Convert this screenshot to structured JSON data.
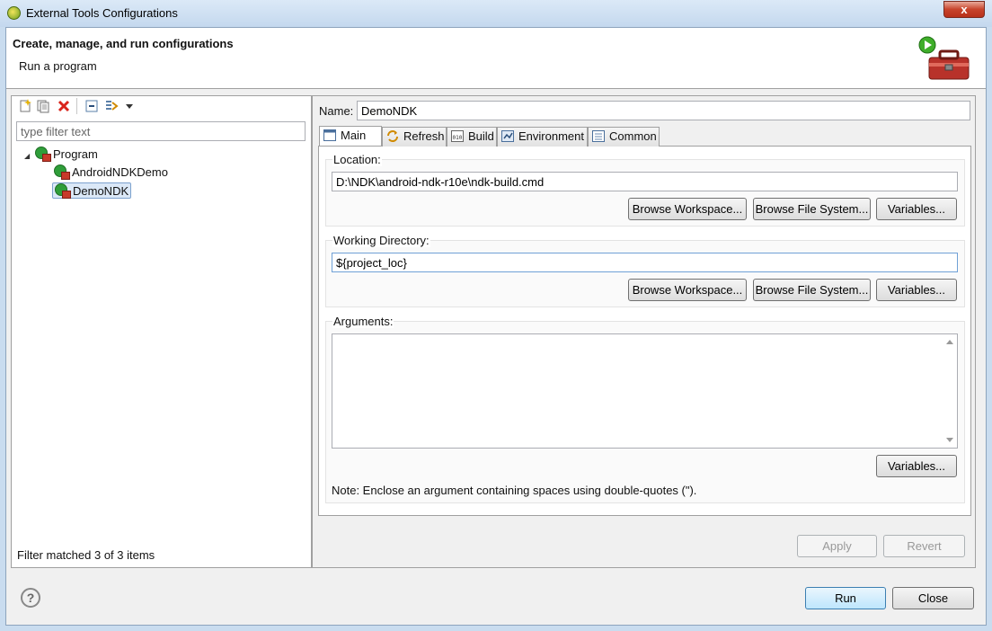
{
  "window": {
    "title": "External Tools Configurations",
    "close_glyph": "x"
  },
  "banner": {
    "title": "Create, manage, and run configurations",
    "subtitle": "Run a program"
  },
  "left": {
    "filter_placeholder": "type filter text",
    "tree": [
      {
        "label": "Program",
        "expander": "◢"
      },
      {
        "label": "AndroidNDKDemo"
      },
      {
        "label": "DemoNDK",
        "selected": true
      }
    ],
    "status": "Filter matched 3 of 3 items"
  },
  "right": {
    "name_label": "Name:",
    "name_value": "DemoNDK",
    "tabs": [
      {
        "label": "Main",
        "active": true
      },
      {
        "label": "Refresh"
      },
      {
        "label": "Build"
      },
      {
        "label": "Environment"
      },
      {
        "label": "Common"
      }
    ],
    "location": {
      "label": "Location:",
      "value": "D:\\NDK\\android-ndk-r10e\\ndk-build.cmd"
    },
    "workdir": {
      "label": "Working Directory:",
      "value": "${project_loc}"
    },
    "browse_workspace": "Browse Workspace...",
    "browse_fs": "Browse File System...",
    "variables": "Variables...",
    "arguments": {
      "label": "Arguments:",
      "value": "",
      "note": "Note: Enclose an argument containing spaces using double-quotes (\")."
    },
    "apply": "Apply",
    "revert": "Revert"
  },
  "footer": {
    "help": "?",
    "run": "Run",
    "close": "Close"
  },
  "colors": {
    "title_gradient_top": "#dbe9f7",
    "selection": "#dbe8f7",
    "run_green": "#2f9e3a",
    "delete_red": "#d9241b"
  }
}
